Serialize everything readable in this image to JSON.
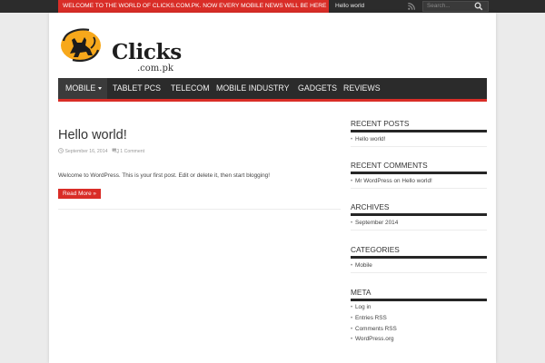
{
  "colors": {
    "accent": "#d92d27",
    "topbar": "#2c2c2c",
    "nav": "#2b2b2b",
    "page": "#ffffff",
    "logo_circle": "#f7a81b"
  },
  "topbar": {
    "ticker_label": "WELCOME TO THE WORLD OF CLICKS.COM.PK. NOW EVERY MOBILE NEWS WILL BE HERE",
    "ticker_item": "Hello world",
    "rss_icon": "rss-icon",
    "search_placeholder": "Search...",
    "search_icon": "search-icon"
  },
  "logo": {
    "word": "Clicks",
    "sub": ".com.pk",
    "icon": "cat-circle-logo"
  },
  "nav": [
    {
      "label": "MOBILE",
      "has_dropdown": true
    },
    {
      "label": "TABLET PCS"
    },
    {
      "label": "TELECOM"
    },
    {
      "label": "MOBILE INDUSTRY"
    },
    {
      "label": "GADGETS"
    },
    {
      "label": "REVIEWS"
    }
  ],
  "post": {
    "title": "Hello world!",
    "date": "September 16, 2014",
    "comments": "1 Comment",
    "excerpt": "Welcome to WordPress. This is your first post. Edit or delete it, then start blogging!",
    "read_more": "Read More »"
  },
  "sidebar": {
    "recent_posts": {
      "title": "RECENT POSTS",
      "items": [
        "Hello world!"
      ]
    },
    "recent_comments": {
      "title": "RECENT COMMENTS",
      "author": "Mr WordPress",
      "connector": "on",
      "post": "Hello world!"
    },
    "archives": {
      "title": "ARCHIVES",
      "items": [
        "September 2014"
      ]
    },
    "categories": {
      "title": "CATEGORIES",
      "items": [
        "Mobile"
      ]
    },
    "meta": {
      "title": "META",
      "items": [
        "Log in",
        "Entries RSS",
        "Comments RSS",
        "WordPress.org"
      ]
    }
  }
}
